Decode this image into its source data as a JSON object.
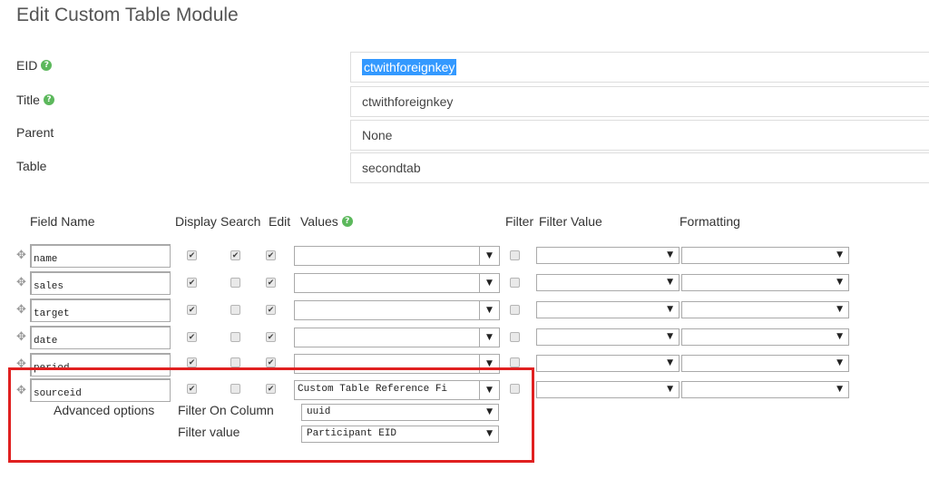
{
  "page_title": "Edit Custom Table Module",
  "form": {
    "eid": {
      "label": "EID",
      "value": "ctwithforeignkey",
      "help_icon": "question-circle-icon"
    },
    "title": {
      "label": "Title",
      "value": "ctwithforeignkey",
      "help_icon": "question-circle-icon"
    },
    "parent": {
      "label": "Parent",
      "value": "None"
    },
    "table": {
      "label": "Table",
      "value": "secondtab"
    }
  },
  "grid": {
    "headers": {
      "field_name": "Field Name",
      "display": "Display",
      "search": "Search",
      "edit": "Edit",
      "values": "Values",
      "filter": "Filter",
      "filter_value": "Filter Value",
      "formatting": "Formatting"
    },
    "rows": [
      {
        "name": "name",
        "display": true,
        "search": true,
        "edit": true,
        "values": "",
        "filter": false
      },
      {
        "name": "sales",
        "display": true,
        "search": false,
        "edit": true,
        "values": "",
        "filter": false
      },
      {
        "name": "target",
        "display": true,
        "search": false,
        "edit": true,
        "values": "",
        "filter": false
      },
      {
        "name": "date",
        "display": true,
        "search": false,
        "edit": true,
        "values": "",
        "filter": false
      },
      {
        "name": "period",
        "display": true,
        "search": false,
        "edit": true,
        "values": "",
        "filter": false
      },
      {
        "name": "sourceid",
        "display": true,
        "search": false,
        "edit": true,
        "values": "Custom Table Reference Fi",
        "filter": false
      }
    ],
    "advanced": {
      "label": "Advanced options",
      "filter_on_column_label": "Filter On Column",
      "filter_on_column_value": "uuid",
      "filter_value_label": "Filter value",
      "filter_value_value": "Participant EID"
    }
  },
  "icons": {
    "drag": "move-icon",
    "check": "✔",
    "dropdown": "▼",
    "help": "?"
  },
  "colors": {
    "highlight": "#e02020",
    "help": "#5cb85c",
    "selection": "#3399ff"
  }
}
